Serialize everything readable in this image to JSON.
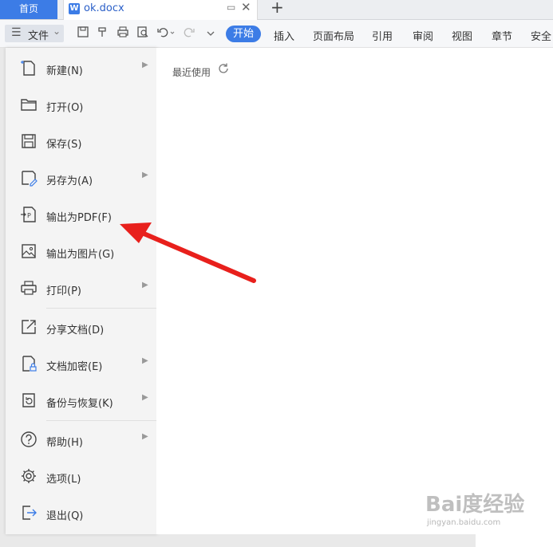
{
  "tabs": {
    "home": "首页",
    "doc_icon": "W",
    "doc_name": "ok.docx",
    "add": "+"
  },
  "toolbar": {
    "file_label": "文件",
    "ribbon_tabs": [
      "开始",
      "插入",
      "页面布局",
      "引用",
      "审阅",
      "视图",
      "章节",
      "安全"
    ]
  },
  "file_menu": {
    "items": [
      {
        "label": "新建(N)",
        "submenu": true
      },
      {
        "label": "打开(O)",
        "submenu": false
      },
      {
        "label": "保存(S)",
        "submenu": false
      },
      {
        "label": "另存为(A)",
        "submenu": true
      },
      {
        "label": "输出为PDF(F)",
        "submenu": false
      },
      {
        "label": "输出为图片(G)",
        "submenu": false
      },
      {
        "label": "打印(P)",
        "submenu": true
      },
      {
        "label": "分享文档(D)",
        "submenu": false
      },
      {
        "label": "文档加密(E)",
        "submenu": true
      },
      {
        "label": "备份与恢复(K)",
        "submenu": true
      },
      {
        "label": "帮助(H)",
        "submenu": true
      },
      {
        "label": "选项(L)",
        "submenu": false
      },
      {
        "label": "退出(Q)",
        "submenu": false
      }
    ]
  },
  "recent": {
    "title": "最近使用"
  },
  "watermark": {
    "logo": "Bai度经验",
    "sub": "jingyan.baidu.com"
  },
  "colors": {
    "accent": "#3c7ce6",
    "arrow": "#e8201c"
  }
}
